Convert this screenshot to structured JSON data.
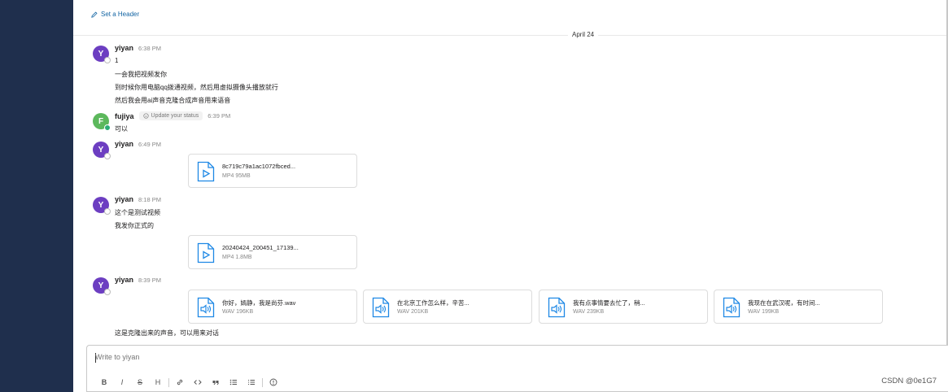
{
  "header": {
    "set_header_label": "Set a Header"
  },
  "date_divider": "April 24",
  "messages": [
    {
      "author": "yiyan",
      "avatar_letter": "Y",
      "time": "6:38 PM",
      "lines": [
        "1",
        "一会我把视频发你",
        "到时候你用电脑qq拨通视频，然后用虚拟摄像头播放就行",
        "然后我会用ai声音克隆合成声音用来语音"
      ]
    },
    {
      "author": "fujiya",
      "avatar_letter": "F",
      "time": "6:39 PM",
      "status": "Update your status",
      "lines": [
        "可以"
      ]
    },
    {
      "author": "yiyan",
      "avatar_letter": "Y",
      "time": "6:49 PM",
      "files": [
        {
          "name": "8c719c79a1ac1072fbced...",
          "meta": "MP4 95MB"
        }
      ]
    },
    {
      "author": "yiyan",
      "avatar_letter": "Y",
      "time": "8:18 PM",
      "lines": [
        "这个是测试视频",
        "我发你正式的"
      ],
      "files": [
        {
          "name": "20240424_200451_17139...",
          "meta": "MP4 1.8MB"
        }
      ]
    },
    {
      "author": "yiyan",
      "avatar_letter": "Y",
      "time": "8:39 PM",
      "files": [
        {
          "name": "你好，嫣静，我是尚芬.wav",
          "meta": "WAV 196KB"
        },
        {
          "name": "在北京工作怎么样，辛苦...",
          "meta": "WAV 201KB"
        },
        {
          "name": "我有点事情要去忙了，稍...",
          "meta": "WAV 239KB"
        },
        {
          "name": "我现在在武汉呢，有时间...",
          "meta": "WAV 199KB"
        }
      ],
      "lines_after": [
        "这是克隆出来的声音，可以用来对话"
      ]
    }
  ],
  "composer": {
    "placeholder": "Write to yiyan",
    "toolbar": [
      {
        "icon": "bold-icon",
        "glyph": "B"
      },
      {
        "icon": "italic-icon",
        "glyph": "I"
      },
      {
        "icon": "strikethrough-icon",
        "glyph": "S"
      },
      {
        "icon": "heading-icon",
        "glyph": "H"
      },
      {
        "icon": "link-icon"
      },
      {
        "icon": "code-icon"
      },
      {
        "icon": "quote-icon"
      },
      {
        "icon": "bulleted-list-icon"
      },
      {
        "icon": "numbered-list-icon"
      },
      {
        "icon": "info-icon"
      }
    ]
  },
  "watermark": "CSDN @0e1G7",
  "colors": {
    "sidebar": "#1f2f4d",
    "avatar_yiyan": "#6c3ec1",
    "avatar_fujiya": "#5cb85c",
    "file_icon": "#1e88e5",
    "link": "#1264a3"
  }
}
